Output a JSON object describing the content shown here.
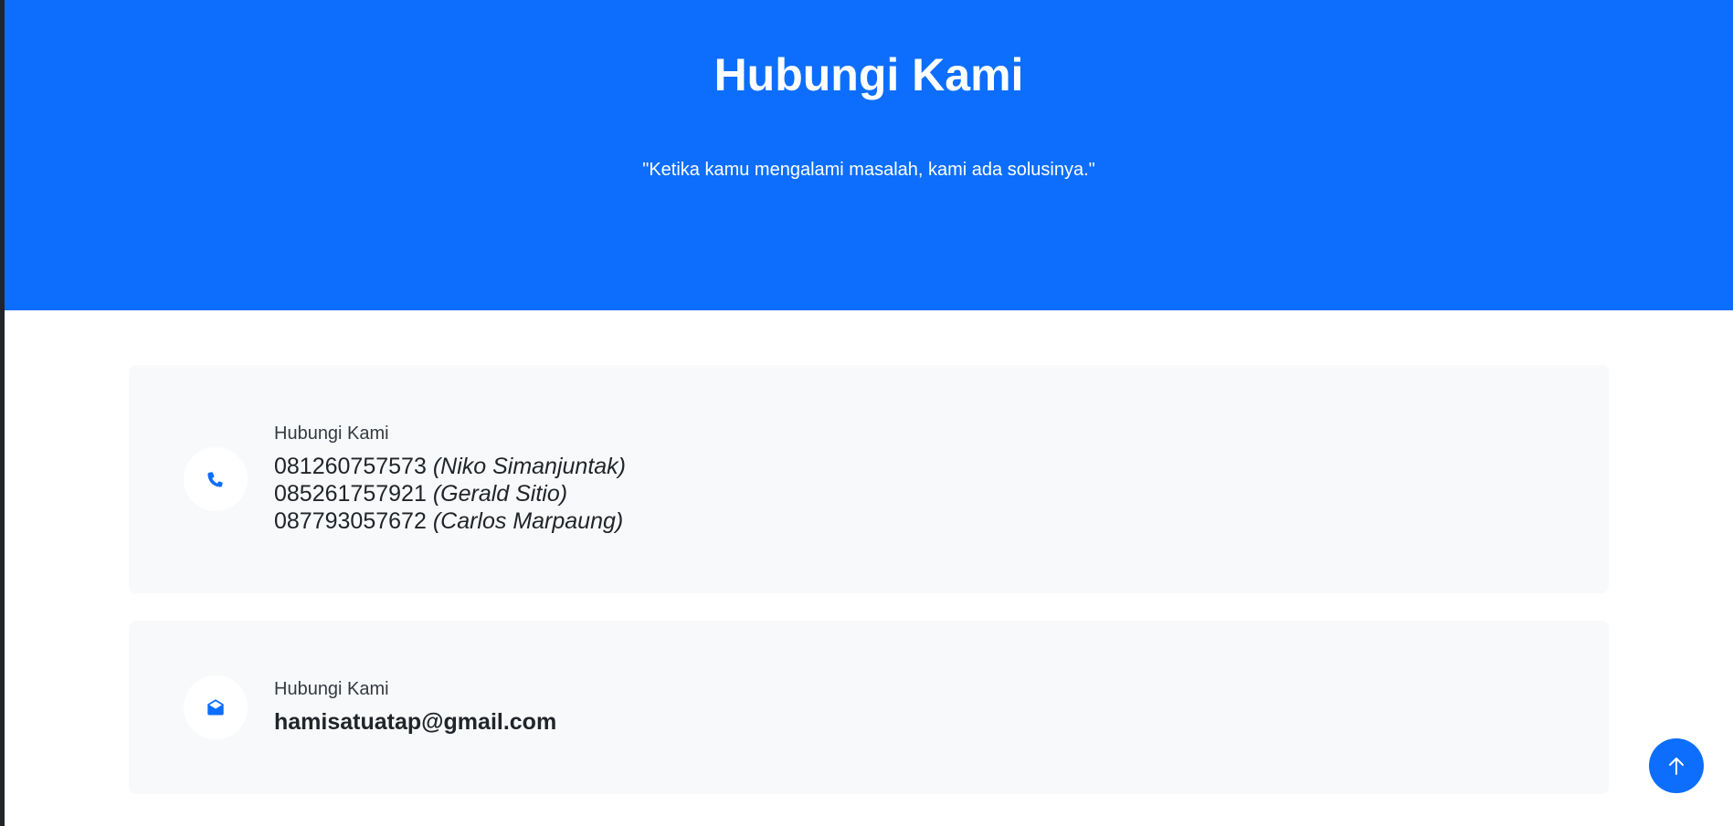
{
  "hero": {
    "title": "Hubungi Kami",
    "subtitle": "\"Ketika kamu mengalami masalah, kami ada solusinya.\"",
    "background_color": "#0d6efd"
  },
  "phone_card": {
    "icon": "phone-icon",
    "label": "Hubungi Kami",
    "contacts": [
      {
        "number": "081260757573",
        "name": "(Niko Simanjuntak)"
      },
      {
        "number": "085261757921",
        "name": "(Gerald Sitio)"
      },
      {
        "number": "087793057672",
        "name": "(Carlos Marpaung)"
      }
    ]
  },
  "email_card": {
    "icon": "envelope-open-icon",
    "label": "Hubungi Kami",
    "email": "hamisatuatap@gmail.com"
  },
  "scroll_top": {
    "icon": "arrow-up-icon"
  },
  "colors": {
    "accent": "#0d6efd",
    "card_background": "#f8f9fa",
    "text": "#212529"
  }
}
